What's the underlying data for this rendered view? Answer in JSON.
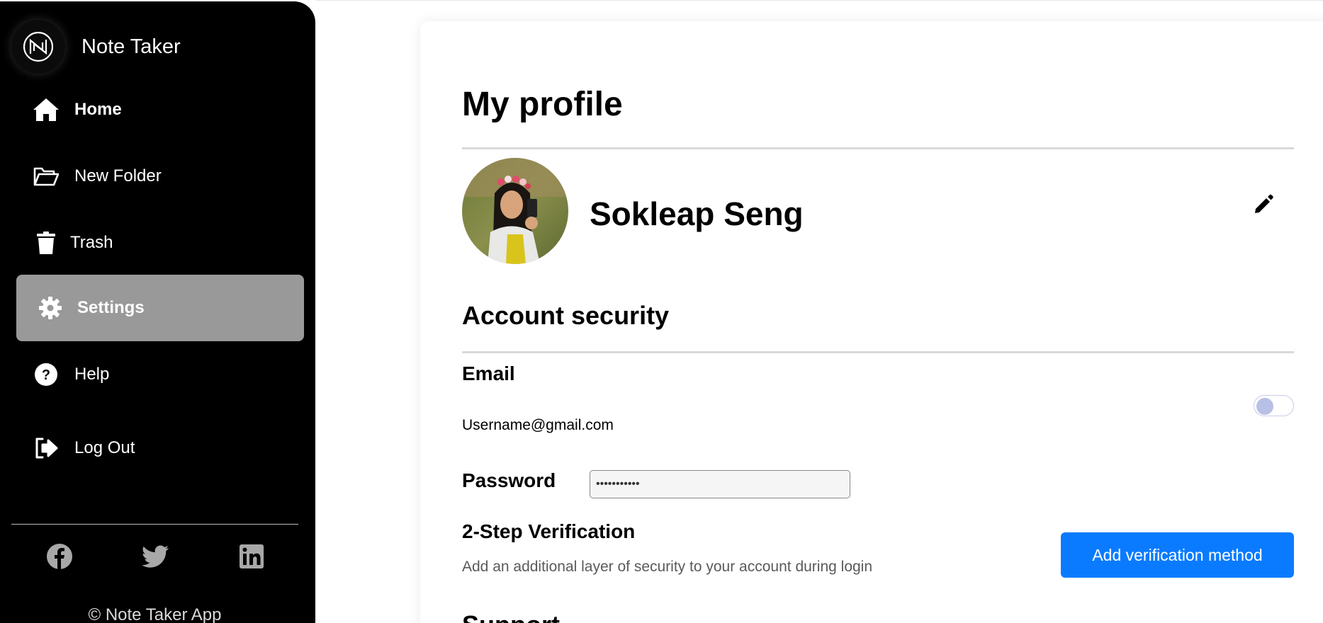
{
  "app": {
    "name": "Note Taker",
    "copyright": "© Note Taker App"
  },
  "sidebar": {
    "items": [
      {
        "label": "Home",
        "icon": "home-icon",
        "active": false,
        "bold": true
      },
      {
        "label": "New Folder",
        "icon": "folder-open-icon",
        "active": false,
        "bold": false
      },
      {
        "label": "Trash",
        "icon": "trash-icon",
        "active": false,
        "bold": false
      },
      {
        "label": "Settings",
        "icon": "gear-icon",
        "active": true,
        "bold": true
      },
      {
        "label": "Help",
        "icon": "help-icon",
        "active": false,
        "bold": false
      },
      {
        "label": "Log Out",
        "icon": "logout-icon",
        "active": false,
        "bold": false
      }
    ],
    "social": [
      "facebook-icon",
      "twitter-icon",
      "linkedin-icon"
    ]
  },
  "profile": {
    "title": "My profile",
    "name": "Sokleap Seng"
  },
  "security": {
    "heading": "Account security",
    "email_label": "Email",
    "email_value": "Username@gmail.com",
    "password_label": "Password",
    "password_value": "•••••••••••",
    "two_step_heading": "2-Step Verification",
    "two_step_desc": "Add an additional layer of security to your account during login",
    "add_method_button": "Add verification method"
  },
  "support": {
    "heading": "Support"
  },
  "colors": {
    "sidebar_bg": "#000000",
    "active_item": "#999999",
    "primary": "#0a7bff",
    "toggle_knob": "#b9c0e6"
  }
}
